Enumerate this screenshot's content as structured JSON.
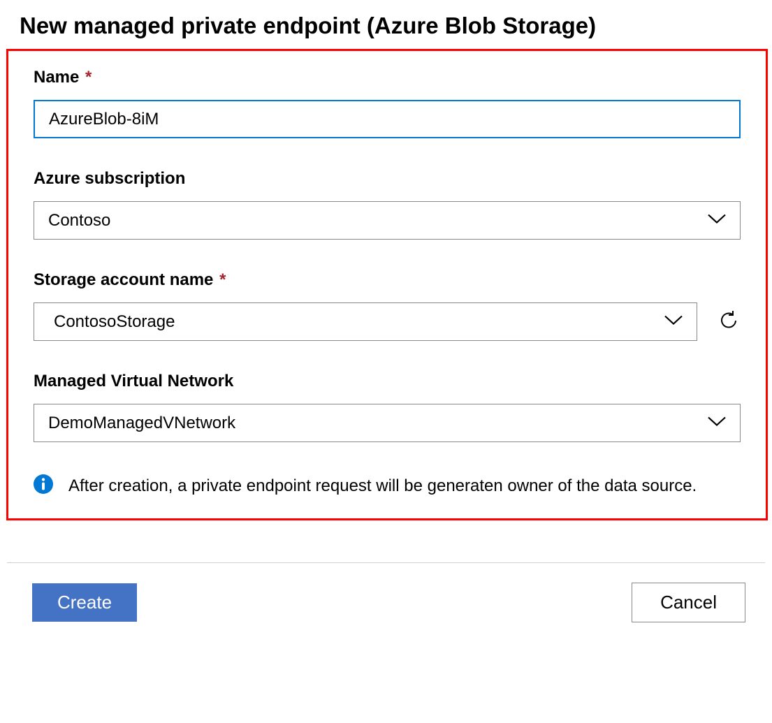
{
  "page_title": "New managed private endpoint (Azure Blob Storage)",
  "fields": {
    "name": {
      "label": "Name",
      "required": true,
      "value": "AzureBlob-8iM"
    },
    "subscription": {
      "label": "Azure subscription",
      "required": false,
      "value": "Contoso"
    },
    "storage_account": {
      "label": "Storage account name",
      "required": true,
      "value": "ContosoStorage"
    },
    "managed_network": {
      "label": "Managed Virtual Network",
      "required": false,
      "value": "DemoManagedVNetwork"
    }
  },
  "info_message": "After creation, a private endpoint request will be generaten owner of the data source.",
  "footer": {
    "create_label": "Create",
    "cancel_label": "Cancel"
  },
  "asterisk": "*",
  "colors": {
    "highlight_border": "#ff0000",
    "input_focus_border": "#0078d4",
    "primary_button": "#4472c4",
    "info_icon": "#0078d4"
  }
}
